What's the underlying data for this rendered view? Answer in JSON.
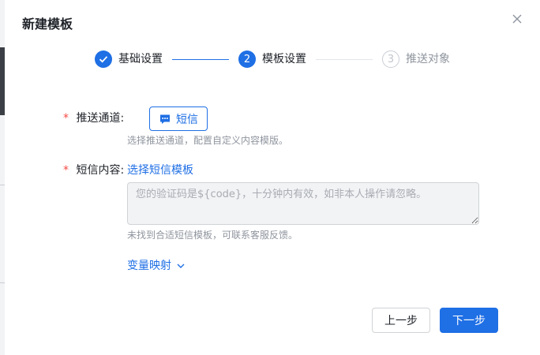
{
  "modal": {
    "title": "新建模板"
  },
  "steps": [
    {
      "index": "1",
      "label": "基础设置",
      "state": "done"
    },
    {
      "index": "2",
      "label": "模板设置",
      "state": "active"
    },
    {
      "index": "3",
      "label": "推送对象",
      "state": "wait"
    }
  ],
  "form": {
    "required_mark": "*",
    "channel": {
      "label": "推送通道:",
      "button_label": "短信",
      "hint": "选择推送通道，配置自定义内容模版。"
    },
    "content": {
      "label": "短信内容:",
      "select_link": "选择短信模板",
      "placeholder": "您的验证码是${code}，十分钟内有效，如非本人操作请忽略。",
      "hint": "未找到合适短信模板，可联系客服反馈。"
    },
    "variable_mapping": "变量映射"
  },
  "footer": {
    "prev_label": "上一步",
    "next_label": "下一步"
  },
  "colors": {
    "primary": "#1f6fe5",
    "required": "#f54a45",
    "hint": "#8f959e"
  }
}
